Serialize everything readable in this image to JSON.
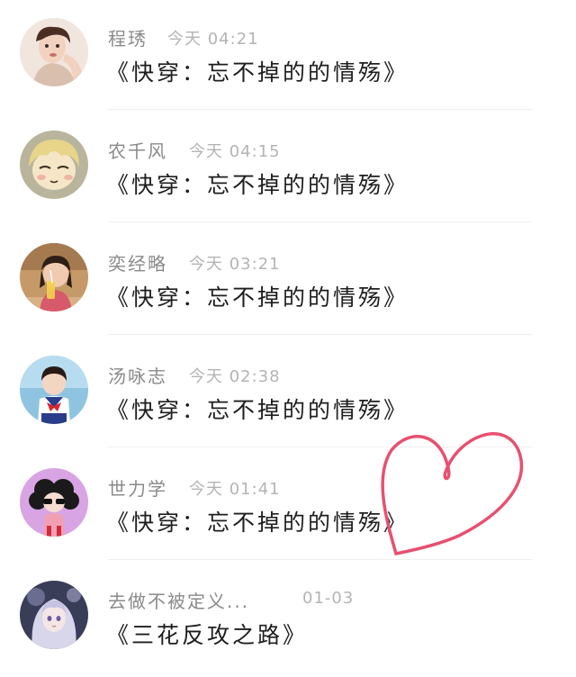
{
  "items": [
    {
      "name": "程琇",
      "time": "今天 04:21",
      "title": "《快穿：忘不掉的的情殇》",
      "avatar_icon": "avatar-girl-photo-icon",
      "avatar_bg": "#e8d8cf"
    },
    {
      "name": "农千风",
      "time": "今天 04:15",
      "title": "《快穿：忘不掉的的情殇》",
      "avatar_icon": "avatar-anime-boy-icon",
      "avatar_bg": "#b9b49a"
    },
    {
      "name": "奕经略",
      "time": "今天 03:21",
      "title": "《快穿：忘不掉的的情殇》",
      "avatar_icon": "avatar-child-drink-icon",
      "avatar_bg": "#c8a070"
    },
    {
      "name": "汤咏志",
      "time": "今天 02:38",
      "title": "《快穿：忘不掉的的情殇》",
      "avatar_icon": "avatar-sailor-girl-icon",
      "avatar_bg": "#7fb8d8"
    },
    {
      "name": "世力学",
      "time": "今天 01:41",
      "title": "《快穿：忘不掉的的情殇》",
      "avatar_icon": "avatar-cartoon-girl-icon",
      "avatar_bg": "#d9a6e6"
    },
    {
      "name": "去做不被定义...",
      "time": "01-03",
      "title": "《三花反攻之路》",
      "avatar_icon": "avatar-anime-princess-icon",
      "avatar_bg": "#3c3f58"
    }
  ],
  "decoration": {
    "heart_icon": "heart-doodle-icon",
    "heart_color": "#e7506e"
  }
}
